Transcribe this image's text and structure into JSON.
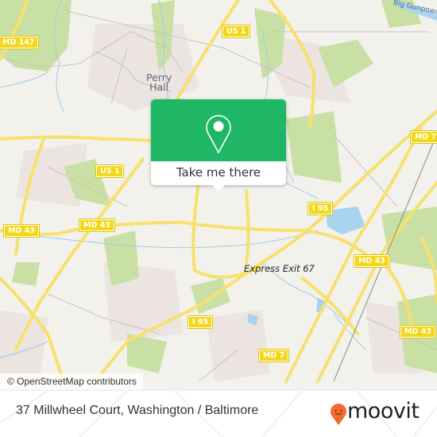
{
  "map": {
    "place_labels": [
      {
        "id": "perry-hall",
        "text_line1": "Perry",
        "text_line2": "Hall"
      }
    ],
    "road_shields": [
      {
        "id": "md147",
        "text": "MD 147"
      },
      {
        "id": "us1-north",
        "text": "US 1"
      },
      {
        "id": "us1-west",
        "text": "US 1"
      },
      {
        "id": "md43-far-west",
        "text": "MD 43"
      },
      {
        "id": "md43-west",
        "text": "MD 43"
      },
      {
        "id": "i95-east",
        "text": "I 95"
      },
      {
        "id": "md7-north",
        "text": "MD 7"
      },
      {
        "id": "md43-east",
        "text": "MD 43"
      },
      {
        "id": "i95-south",
        "text": "I 95"
      },
      {
        "id": "md7-south",
        "text": "MD 7"
      },
      {
        "id": "md43-se",
        "text": "MD 43"
      }
    ],
    "exit_label": "Express Exit 67",
    "river_label": "Big Gunpowder",
    "colors": {
      "background": "#f2f1ec",
      "park": "#c8e0a4",
      "water": "#a8d4ef",
      "road": "#f7e16b",
      "shield": "#f4d818"
    }
  },
  "popup": {
    "icon": "map-pin-icon",
    "button_label": "Take me there",
    "color": "#1fb765"
  },
  "attribution": "© OpenStreetMap contributors",
  "footer": {
    "title": "37 Millwheel Court, Washington / Baltimore",
    "brand": "moovit",
    "brand_color": "#f26a32"
  }
}
